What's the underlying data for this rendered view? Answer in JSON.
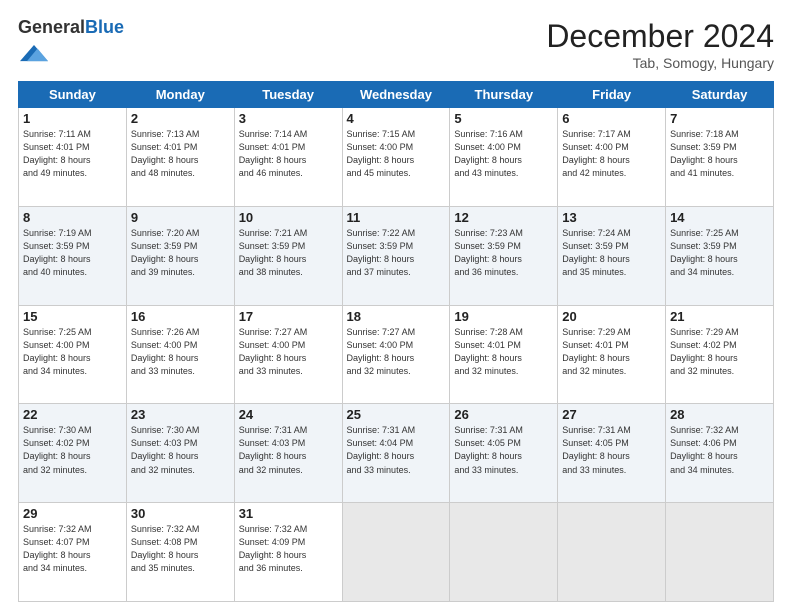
{
  "header": {
    "logo_general": "General",
    "logo_blue": "Blue",
    "month_title": "December 2024",
    "location": "Tab, Somogy, Hungary"
  },
  "days_of_week": [
    "Sunday",
    "Monday",
    "Tuesday",
    "Wednesday",
    "Thursday",
    "Friday",
    "Saturday"
  ],
  "weeks": [
    [
      {
        "day": "1",
        "sunrise": "7:11 AM",
        "sunset": "4:01 PM",
        "daylight": "8 hours and 49 minutes."
      },
      {
        "day": "2",
        "sunrise": "7:13 AM",
        "sunset": "4:01 PM",
        "daylight": "8 hours and 48 minutes."
      },
      {
        "day": "3",
        "sunrise": "7:14 AM",
        "sunset": "4:01 PM",
        "daylight": "8 hours and 46 minutes."
      },
      {
        "day": "4",
        "sunrise": "7:15 AM",
        "sunset": "4:00 PM",
        "daylight": "8 hours and 45 minutes."
      },
      {
        "day": "5",
        "sunrise": "7:16 AM",
        "sunset": "4:00 PM",
        "daylight": "8 hours and 43 minutes."
      },
      {
        "day": "6",
        "sunrise": "7:17 AM",
        "sunset": "4:00 PM",
        "daylight": "8 hours and 42 minutes."
      },
      {
        "day": "7",
        "sunrise": "7:18 AM",
        "sunset": "3:59 PM",
        "daylight": "8 hours and 41 minutes."
      }
    ],
    [
      {
        "day": "8",
        "sunrise": "7:19 AM",
        "sunset": "3:59 PM",
        "daylight": "8 hours and 40 minutes."
      },
      {
        "day": "9",
        "sunrise": "7:20 AM",
        "sunset": "3:59 PM",
        "daylight": "8 hours and 39 minutes."
      },
      {
        "day": "10",
        "sunrise": "7:21 AM",
        "sunset": "3:59 PM",
        "daylight": "8 hours and 38 minutes."
      },
      {
        "day": "11",
        "sunrise": "7:22 AM",
        "sunset": "3:59 PM",
        "daylight": "8 hours and 37 minutes."
      },
      {
        "day": "12",
        "sunrise": "7:23 AM",
        "sunset": "3:59 PM",
        "daylight": "8 hours and 36 minutes."
      },
      {
        "day": "13",
        "sunrise": "7:24 AM",
        "sunset": "3:59 PM",
        "daylight": "8 hours and 35 minutes."
      },
      {
        "day": "14",
        "sunrise": "7:25 AM",
        "sunset": "3:59 PM",
        "daylight": "8 hours and 34 minutes."
      }
    ],
    [
      {
        "day": "15",
        "sunrise": "7:25 AM",
        "sunset": "4:00 PM",
        "daylight": "8 hours and 34 minutes."
      },
      {
        "day": "16",
        "sunrise": "7:26 AM",
        "sunset": "4:00 PM",
        "daylight": "8 hours and 33 minutes."
      },
      {
        "day": "17",
        "sunrise": "7:27 AM",
        "sunset": "4:00 PM",
        "daylight": "8 hours and 33 minutes."
      },
      {
        "day": "18",
        "sunrise": "7:27 AM",
        "sunset": "4:00 PM",
        "daylight": "8 hours and 32 minutes."
      },
      {
        "day": "19",
        "sunrise": "7:28 AM",
        "sunset": "4:01 PM",
        "daylight": "8 hours and 32 minutes."
      },
      {
        "day": "20",
        "sunrise": "7:29 AM",
        "sunset": "4:01 PM",
        "daylight": "8 hours and 32 minutes."
      },
      {
        "day": "21",
        "sunrise": "7:29 AM",
        "sunset": "4:02 PM",
        "daylight": "8 hours and 32 minutes."
      }
    ],
    [
      {
        "day": "22",
        "sunrise": "7:30 AM",
        "sunset": "4:02 PM",
        "daylight": "8 hours and 32 minutes."
      },
      {
        "day": "23",
        "sunrise": "7:30 AM",
        "sunset": "4:03 PM",
        "daylight": "8 hours and 32 minutes."
      },
      {
        "day": "24",
        "sunrise": "7:31 AM",
        "sunset": "4:03 PM",
        "daylight": "8 hours and 32 minutes."
      },
      {
        "day": "25",
        "sunrise": "7:31 AM",
        "sunset": "4:04 PM",
        "daylight": "8 hours and 33 minutes."
      },
      {
        "day": "26",
        "sunrise": "7:31 AM",
        "sunset": "4:05 PM",
        "daylight": "8 hours and 33 minutes."
      },
      {
        "day": "27",
        "sunrise": "7:31 AM",
        "sunset": "4:05 PM",
        "daylight": "8 hours and 33 minutes."
      },
      {
        "day": "28",
        "sunrise": "7:32 AM",
        "sunset": "4:06 PM",
        "daylight": "8 hours and 34 minutes."
      }
    ],
    [
      {
        "day": "29",
        "sunrise": "7:32 AM",
        "sunset": "4:07 PM",
        "daylight": "8 hours and 34 minutes."
      },
      {
        "day": "30",
        "sunrise": "7:32 AM",
        "sunset": "4:08 PM",
        "daylight": "8 hours and 35 minutes."
      },
      {
        "day": "31",
        "sunrise": "7:32 AM",
        "sunset": "4:09 PM",
        "daylight": "8 hours and 36 minutes."
      },
      null,
      null,
      null,
      null
    ]
  ]
}
